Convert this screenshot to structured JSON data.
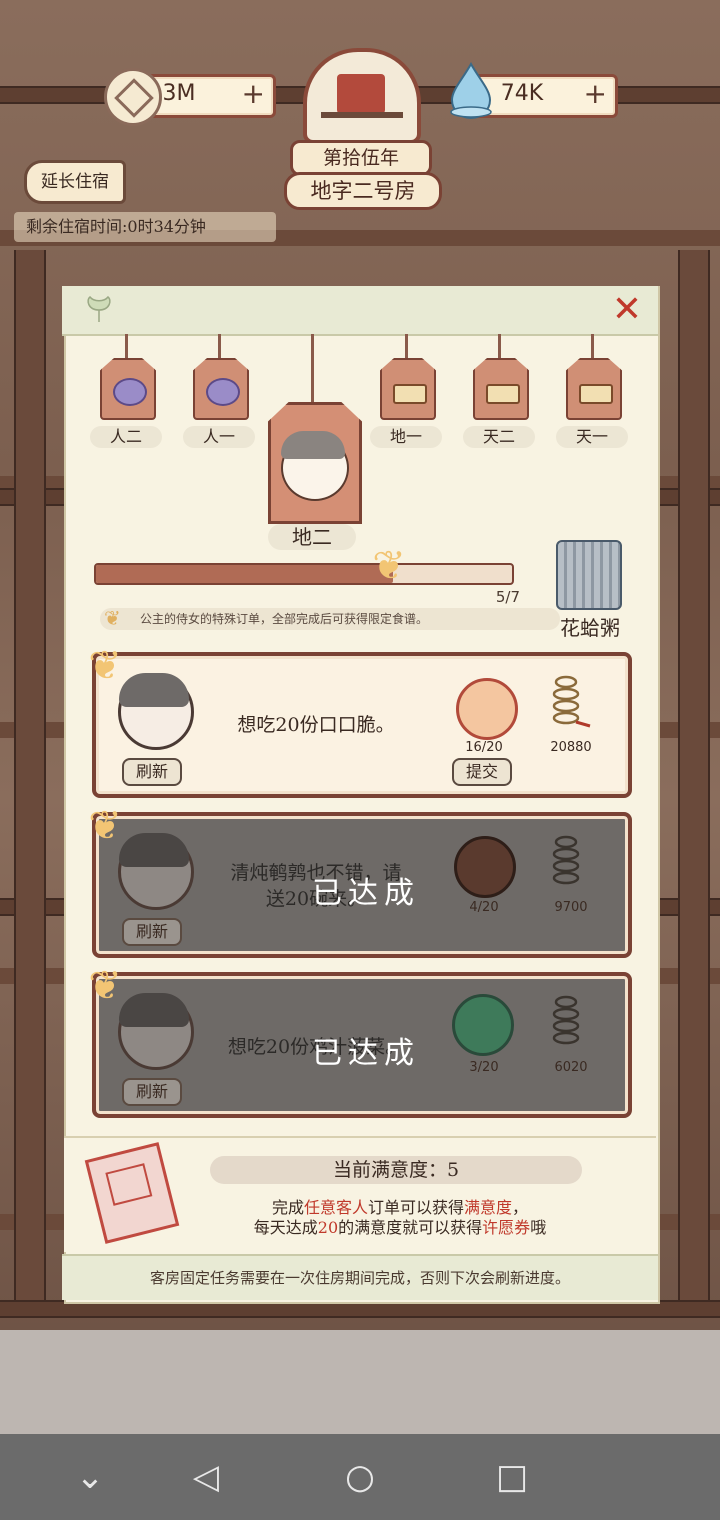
{
  "currency": {
    "coins": "3M",
    "jade": "74K"
  },
  "header": {
    "year": "第拾伍年",
    "room": "地字二号房",
    "extend_button": "延长住宿",
    "remaining_time": "剩余住宿时间:0时34分钟"
  },
  "tabs": [
    {
      "label": "人二",
      "icon": "purple-pouch-icon"
    },
    {
      "label": "人一",
      "icon": "purple-pouch-icon"
    },
    {
      "label": "地一",
      "icon": "box-icon"
    },
    {
      "label": "天二",
      "icon": "box-icon"
    },
    {
      "label": "天一",
      "icon": "box-icon"
    }
  ],
  "selected_tab": {
    "label": "地二"
  },
  "progress": {
    "current": 5,
    "total": 7,
    "text": "5/7",
    "hint": "公主的侍女的特殊订单，全部完成后可获得限定食谱。",
    "reward_name": "花蛤粥"
  },
  "orders": [
    {
      "request": "想吃20份口口脆。",
      "dish_count": "16/20",
      "reward": "20880",
      "refresh": "刷新",
      "submit": "提交",
      "status": "active"
    },
    {
      "request_line1": "清炖鹌鹑也不错，请",
      "request_line2": "送20碗来。",
      "dish_count": "4/20",
      "reward": "9700",
      "refresh": "刷新",
      "status_label": "已达成"
    },
    {
      "request": "想吃20份鸡汁菠菜。",
      "dish_count": "3/20",
      "reward": "6020",
      "refresh": "刷新",
      "status_label": "已达成"
    }
  ],
  "satisfaction": {
    "title": "当前满意度：5",
    "line1_a": "完成",
    "line1_b": "任意客人",
    "line1_c": "订单可以获得",
    "line1_d": "满意度",
    "line1_e": "，",
    "line2_a": "每天达成",
    "line2_b": "20",
    "line2_c": "的满意度就可以获得",
    "line2_d": "许愿券",
    "line2_e": "哦"
  },
  "footer_note": "客房固定任务需要在一次住房期间完成，否则下次会刷新进度。",
  "colors": {
    "accent_red": "#c0392b",
    "frame_brown": "#7a4234",
    "panel_bg": "#f8f3e2"
  }
}
